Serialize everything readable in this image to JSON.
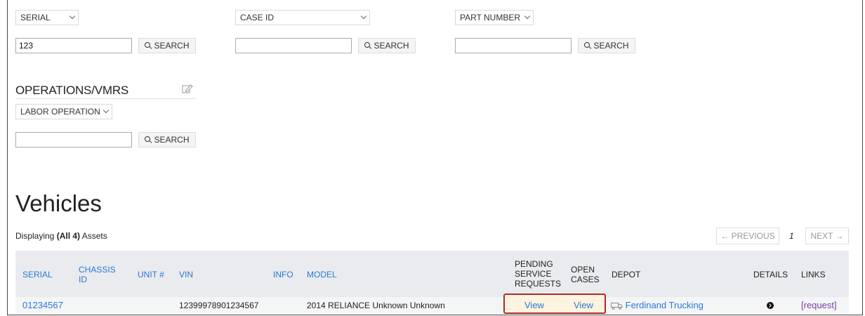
{
  "filters": {
    "serial": {
      "label": "SERIAL",
      "value": "123"
    },
    "case_id": {
      "label": "CASE ID",
      "value": ""
    },
    "part_number": {
      "label": "PART NUMBER",
      "value": ""
    },
    "search_label": "SEARCH"
  },
  "operations": {
    "title": "OPERATIONS/VMRS",
    "dropdown_label": "LABOR OPERATION",
    "value": "",
    "search_label": "SEARCH"
  },
  "vehicles": {
    "title": "Vehicles",
    "displaying_prefix": "Displaying ",
    "displaying_count": "(All 4)",
    "displaying_suffix": " Assets",
    "pager": {
      "previous": "← PREVIOUS",
      "page": "1",
      "next": "NEXT →"
    },
    "columns": {
      "serial": "SERIAL",
      "chassis_id_1": "CHASSIS",
      "chassis_id_2": "ID",
      "unit": "UNIT #",
      "vin": "VIN",
      "info": "INFO",
      "model": "MODEL",
      "pending_1": "PENDING",
      "pending_2": "SERVICE",
      "pending_3": "REQUESTS",
      "open_1": "OPEN",
      "open_2": "CASES",
      "depot": "DEPOT",
      "details": "DETAILS",
      "links": "LINKS"
    },
    "rows": [
      {
        "serial": "01234567",
        "vin": "12399978901234567",
        "model": "2014 RELIANCE Unknown Unknown",
        "pending": "View",
        "open": "View",
        "depot": "Ferdinand Trucking",
        "links": "[request]"
      }
    ]
  },
  "colors": {
    "link": "#2a78d6",
    "header_bg": "#e9ebee",
    "highlight_border": "#b02a2a",
    "visited_link": "#7a3e9d"
  }
}
